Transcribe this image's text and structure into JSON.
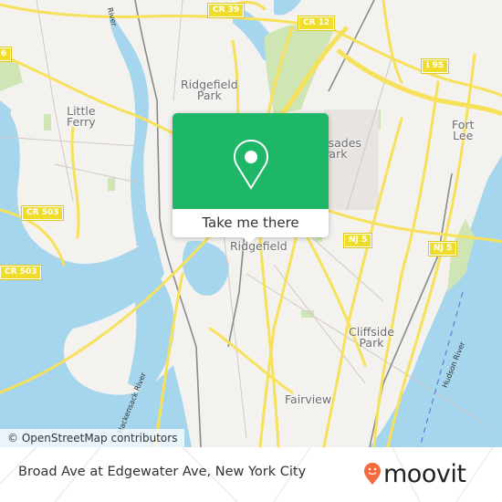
{
  "map": {
    "places": [
      {
        "id": "ridgefield-park",
        "lines": [
          "Ridgefield",
          "Park"
        ]
      },
      {
        "id": "little-ferry",
        "lines": [
          "Little",
          "Ferry"
        ]
      },
      {
        "id": "palisades-park",
        "lines": [
          "Palisades",
          "Park"
        ]
      },
      {
        "id": "fort-lee",
        "lines": [
          "Fort",
          "Lee"
        ]
      },
      {
        "id": "ridgefield",
        "lines": [
          "Ridgefield"
        ]
      },
      {
        "id": "cliffside-park",
        "lines": [
          "Cliffside",
          "Park"
        ]
      },
      {
        "id": "fairview",
        "lines": [
          "Fairview"
        ]
      }
    ],
    "shields": [
      {
        "id": "cr-39",
        "label": "CR 39"
      },
      {
        "id": "cr-12",
        "label": "CR 12"
      },
      {
        "id": "i-95",
        "label": "I 95"
      },
      {
        "id": "cr-46",
        "label": "6"
      },
      {
        "id": "cr-503-a",
        "label": "CR 503"
      },
      {
        "id": "cr-503-b",
        "label": "CR 503"
      },
      {
        "id": "nj-5-a",
        "label": "NJ 5"
      },
      {
        "id": "nj-5-b",
        "label": "NJ 5"
      }
    ],
    "water_labels": {
      "hudson": "Hudson River",
      "hackensack": "Hackensack River",
      "top_river": "River"
    },
    "colors": {
      "land": "#f3f2ee",
      "water": "#a6d6ee",
      "road": "#f7e15a",
      "park": "#cfe6b4",
      "popup": "#1eb768",
      "brand_pin": "#f26a3d"
    }
  },
  "popup": {
    "icon": "map-pin-icon",
    "button_label": "Take me there"
  },
  "attribution": "© OpenStreetMap contributors",
  "footer": {
    "title": "Broad Ave at Edgewater Ave, New York City",
    "logo_text": "moovit"
  }
}
